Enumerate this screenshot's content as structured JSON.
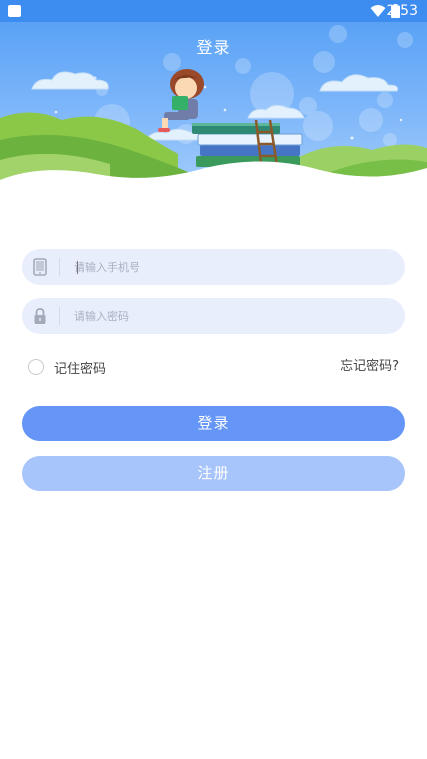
{
  "status_bar": {
    "time": "2:53"
  },
  "header": {
    "title": "登录"
  },
  "login_form": {
    "phone_placeholder": "请输入手机号",
    "password_placeholder": "请输入密码",
    "remember_label": "记住密码",
    "forgot_label": "忘记密码?",
    "login_button": "登录",
    "register_button": "注册"
  },
  "colors": {
    "status_bar": "#3d8cf0",
    "primary_button": "#6495f7",
    "secondary_button": "#a7c4fb",
    "input_background": "#e9eefd"
  },
  "icons": [
    "notification-icon",
    "wifi-icon",
    "battery-icon",
    "phone-icon",
    "lock-icon"
  ]
}
